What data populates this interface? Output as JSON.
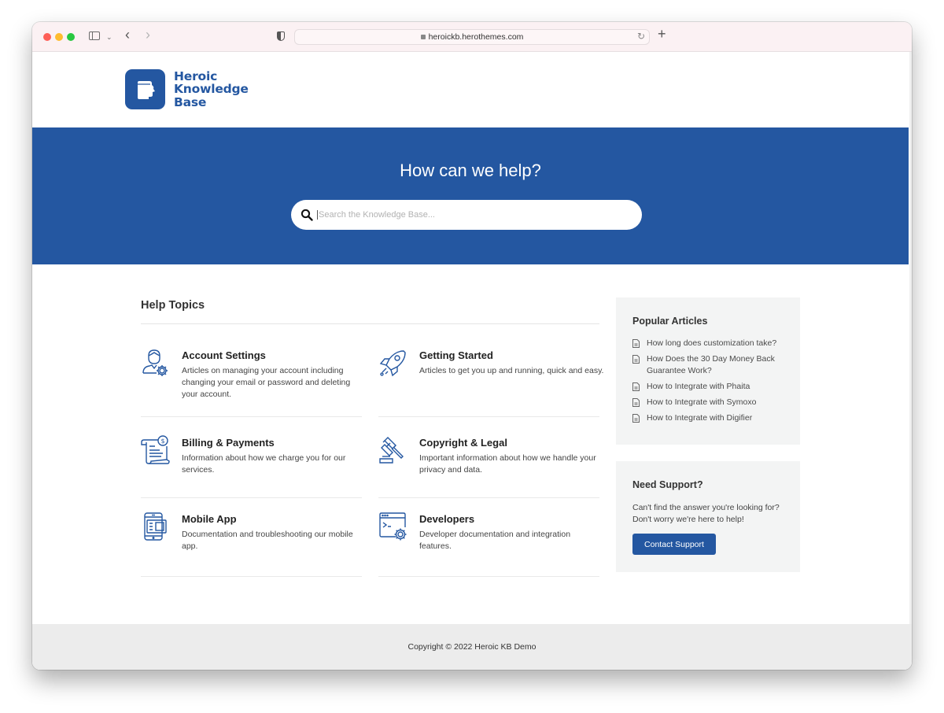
{
  "browser": {
    "url": "heroickb.herothemes.com",
    "icons": [
      "close-window",
      "minimize-window",
      "zoom-window",
      "sidebar-toggle-icon",
      "chevron-down-icon",
      "back-icon",
      "forward-icon",
      "privacy-shield-icon",
      "lock-icon",
      "reload-icon",
      "new-tab-icon"
    ]
  },
  "header": {
    "logo": {
      "line1": "Heroic",
      "line2": "Knowledge",
      "line3": "Base",
      "icon": "book-head-icon"
    }
  },
  "hero": {
    "title": "How can we help?",
    "search_placeholder": "Search the Knowledge Base...",
    "search_value": ""
  },
  "help_topics": {
    "title": "Help Topics",
    "topics": [
      {
        "icon": "user-gear-icon",
        "title": "Account Settings",
        "description": "Articles on managing your account including changing your email or password and deleting your account."
      },
      {
        "icon": "rocket-icon",
        "title": "Getting Started",
        "description": "Articles to get you up and running, quick and easy."
      },
      {
        "icon": "invoice-scroll-icon",
        "title": "Billing & Payments",
        "description": "Information about how we charge you for our services."
      },
      {
        "icon": "gavel-icon",
        "title": "Copyright & Legal",
        "description": "Important information about how we handle your privacy and data."
      },
      {
        "icon": "mobile-app-icon",
        "title": "Mobile App",
        "description": "Documentation and troubleshooting our mobile app."
      },
      {
        "icon": "code-window-gear-icon",
        "title": "Developers",
        "description": "Developer documentation and integration features."
      }
    ]
  },
  "popular_articles": {
    "title": "Popular Articles",
    "items": [
      "How long does customization take?",
      "How Does the 30 Day Money Back Guarantee Work?",
      "How to Integrate with Phaita",
      "How to Integrate with Symoxo",
      "How to Integrate with Digifier"
    ]
  },
  "support": {
    "title": "Need Support?",
    "text": "Can't find the answer you're looking for? Don't worry we're here to help!",
    "button_label": "Contact Support"
  },
  "footer": {
    "copyright": "Copyright © 2022 Heroic KB Demo"
  },
  "colors": {
    "brand": "#2457a1",
    "sidebar_bg": "#f3f4f4",
    "footer_bg": "#ececec"
  }
}
